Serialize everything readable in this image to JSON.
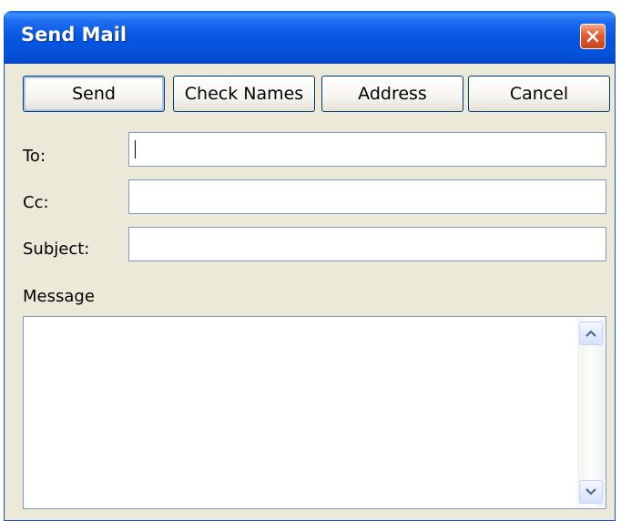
{
  "window": {
    "title": "Send Mail"
  },
  "toolbar": {
    "send_label": "Send",
    "check_names_label": "Check Names",
    "address_label": "Address",
    "cancel_label": "Cancel"
  },
  "form": {
    "to_label": "To:",
    "to_value": "",
    "cc_label": "Cc:",
    "cc_value": "",
    "subject_label": "Subject:",
    "subject_value": "",
    "message_label": "Message",
    "message_value": ""
  },
  "icons": {
    "close": "close-icon",
    "scroll_up": "chevron-up-icon",
    "scroll_down": "chevron-down-icon"
  },
  "colors": {
    "titlebar": "#0656e3",
    "window_bg": "#ece9d8",
    "close_button": "#e25c2e",
    "field_border": "#7f9db9",
    "button_border": "#003c74"
  }
}
